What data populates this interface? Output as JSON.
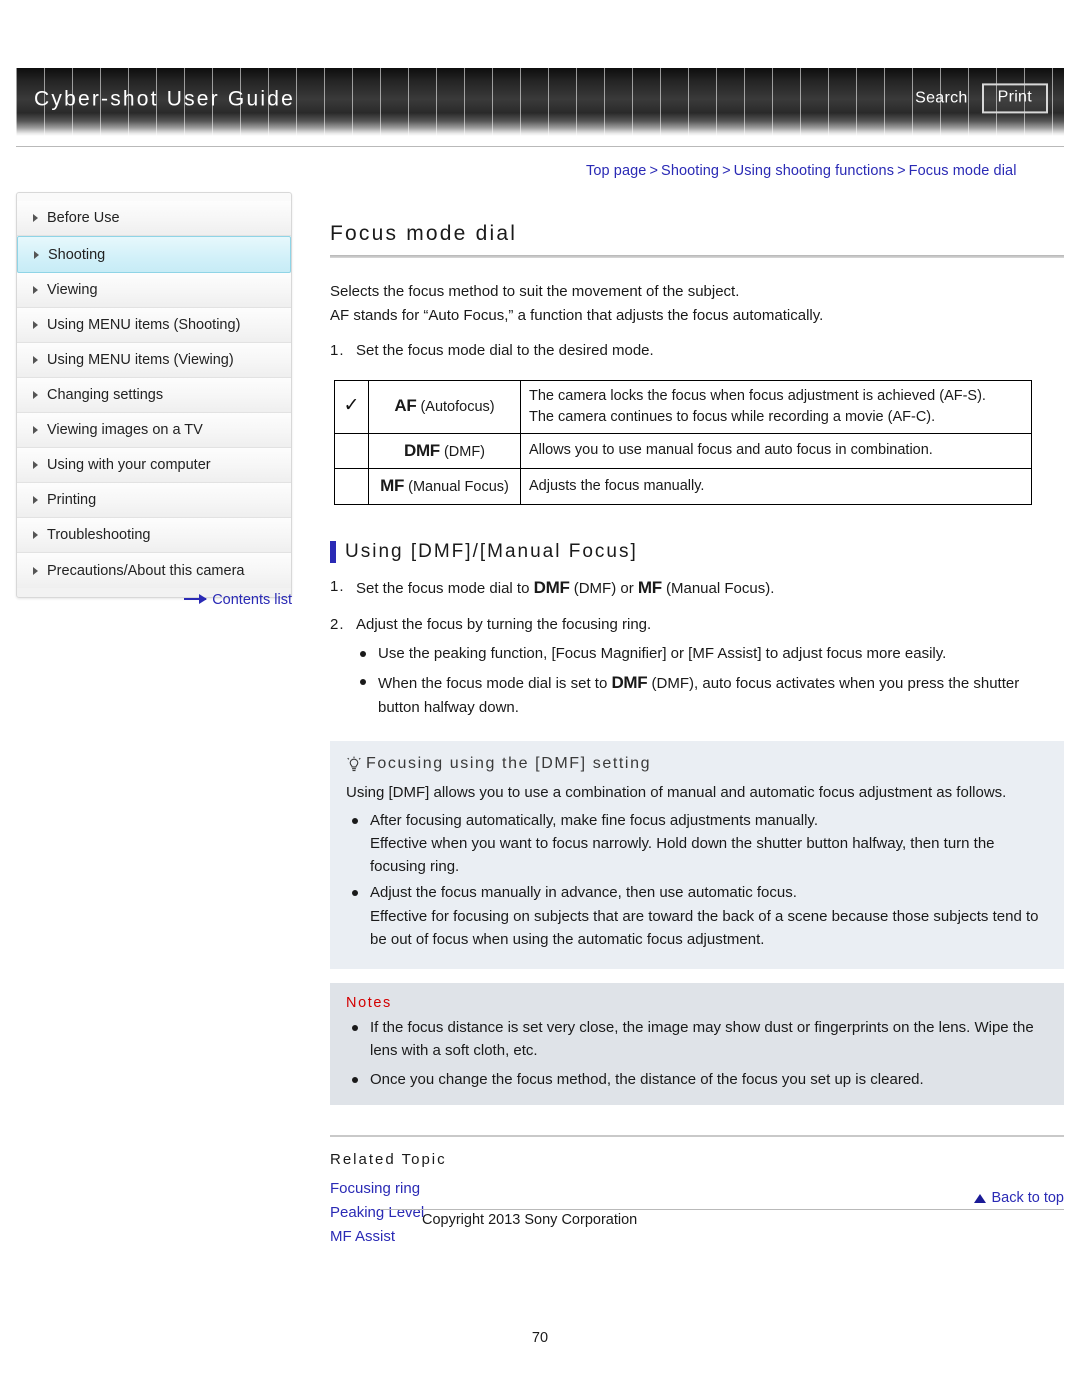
{
  "header": {
    "title": "Cyber-shot User Guide",
    "search_label": "Search",
    "print_label": "Print"
  },
  "breadcrumb": {
    "items": [
      "Top page",
      "Shooting",
      "Using shooting functions",
      "Focus mode dial"
    ],
    "separator": ">"
  },
  "sidebar": {
    "items": [
      {
        "label": "Before Use",
        "active": false
      },
      {
        "label": "Shooting",
        "active": true
      },
      {
        "label": "Viewing",
        "active": false
      },
      {
        "label": "Using MENU items (Shooting)",
        "active": false
      },
      {
        "label": "Using MENU items (Viewing)",
        "active": false
      },
      {
        "label": "Changing settings",
        "active": false
      },
      {
        "label": "Viewing images on a TV",
        "active": false
      },
      {
        "label": "Using with your computer",
        "active": false
      },
      {
        "label": "Printing",
        "active": false
      },
      {
        "label": "Troubleshooting",
        "active": false
      },
      {
        "label": "Precautions/About this camera",
        "active": false
      }
    ],
    "contents_link": "Contents list"
  },
  "main": {
    "title": "Focus mode dial",
    "intro_line1": "Selects the focus method to suit the movement of the subject.",
    "intro_line2": "AF stands for “Auto Focus,” a function that adjusts the focus automatically.",
    "step1_num": "1.",
    "step1_text": "Set the focus mode dial to the desired mode.",
    "table": {
      "rows": [
        {
          "checked": true,
          "check_glyph": "✓",
          "dial": "AF",
          "name": "(Autofocus)",
          "desc_line1": "The camera locks the focus when focus adjustment is achieved (AF-S).",
          "desc_line2": "The camera continues to focus while recording a movie (AF-C)."
        },
        {
          "checked": false,
          "check_glyph": "",
          "dial": "DMF",
          "name": "(DMF)",
          "desc_line1": "Allows you to use manual focus and auto focus in combination.",
          "desc_line2": ""
        },
        {
          "checked": false,
          "check_glyph": "",
          "dial": "MF",
          "name": "(Manual Focus)",
          "desc_line1": "Adjusts the focus manually.",
          "desc_line2": ""
        }
      ]
    },
    "section": {
      "heading": "Using [DMF]/[Manual Focus]",
      "step1_num": "1.",
      "step1_a": "Set the focus mode dial to ",
      "step1_dmf": "DMF",
      "step1_b": " (DMF) or ",
      "step1_mf": "MF",
      "step1_c": " (Manual Focus).",
      "step2_num": "2.",
      "step2_text": "Adjust the focus by turning the focusing ring.",
      "bullet1": "Use the peaking function, [Focus Magnifier] or [MF Assist] to adjust focus more easily.",
      "bullet2_a": "When the focus mode dial is set to ",
      "bullet2_dmf": "DMF",
      "bullet2_b": " (DMF), auto focus activates when you press the shutter button halfway down."
    },
    "tip": {
      "heading": "Focusing using the [DMF] setting",
      "body": "Using [DMF] allows you to use a combination of manual and automatic focus adjustment as follows.",
      "items": [
        {
          "lead": "After focusing automatically, make fine focus adjustments manually.",
          "detail": "Effective when you want to focus narrowly. Hold down the shutter button halfway, then turn the focusing ring."
        },
        {
          "lead": "Adjust the focus manually in advance, then use automatic focus.",
          "detail": "Effective for focusing on subjects that are toward the back of a scene because those subjects tend to be out of focus when using the automatic focus adjustment."
        }
      ]
    },
    "notes": {
      "title": "Notes",
      "color": "#d30000",
      "items": [
        "If the focus distance is set very close, the image may show dust or fingerprints on the lens. Wipe the lens with a soft cloth, etc.",
        "Once you change the focus method, the distance of the focus you set up is cleared."
      ]
    },
    "related": {
      "title": "Related Topic",
      "links": [
        "Focusing ring",
        "Peaking Level",
        "MF Assist"
      ]
    }
  },
  "footer": {
    "back_to_top": "Back to top",
    "copyright": "Copyright 2013 Sony Corporation",
    "page_number": "70"
  },
  "colors": {
    "link": "#2a2ab5",
    "accent_bar": "#2a2ab5",
    "notes": "#d30000",
    "tip_bg": "#eaeef3",
    "notes_bg": "#dfe3e8",
    "active_nav": "#d3f1f9"
  }
}
